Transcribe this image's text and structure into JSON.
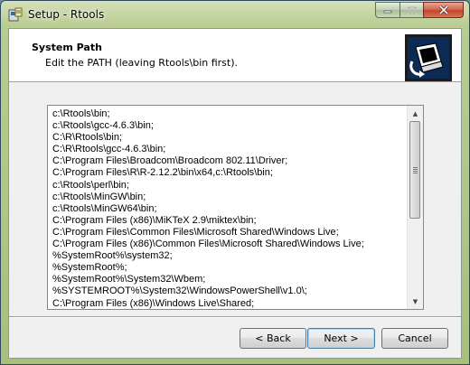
{
  "window": {
    "title": "Setup - Rtools"
  },
  "header": {
    "title": "System Path",
    "subtitle": "Edit the PATH (leaving Rtools\\bin first)."
  },
  "path_editor": {
    "lines": [
      "c:\\Rtools\\bin;",
      "c:\\Rtools\\gcc-4.6.3\\bin;",
      "C:\\R\\Rtools\\bin;",
      "C:\\R\\Rtools\\gcc-4.6.3\\bin;",
      "C:\\Program Files\\Broadcom\\Broadcom 802.11\\Driver;",
      "C:\\Program Files\\R\\R-2.12.2\\bin\\x64,c:\\Rtools\\bin;",
      "c:\\Rtools\\perl\\bin;",
      "c:\\Rtools\\MinGW\\bin;",
      "c:\\Rtools\\MinGW64\\bin;",
      "C:\\Program Files (x86)\\MiKTeX 2.9\\miktex\\bin;",
      "C:\\Program Files\\Common Files\\Microsoft Shared\\Windows Live;",
      "C:\\Program Files (x86)\\Common Files\\Microsoft Shared\\Windows Live;",
      "%SystemRoot%\\system32;",
      "%SystemRoot%;",
      "%SystemRoot%\\System32\\Wbem;",
      "%SYSTEMROOT%\\System32\\WindowsPowerShell\\v1.0\\;",
      "C:\\Program Files (x86)\\Windows Live\\Shared;"
    ]
  },
  "buttons": {
    "back": "< Back",
    "next": "Next >",
    "cancel": "Cancel"
  },
  "icons": {
    "app": "installer-icon",
    "header": "computer-setup-icon"
  },
  "colors": {
    "titlebar": "#b9cc92",
    "close_button": "#c2452a",
    "default_button_border": "#3c7fb1"
  }
}
